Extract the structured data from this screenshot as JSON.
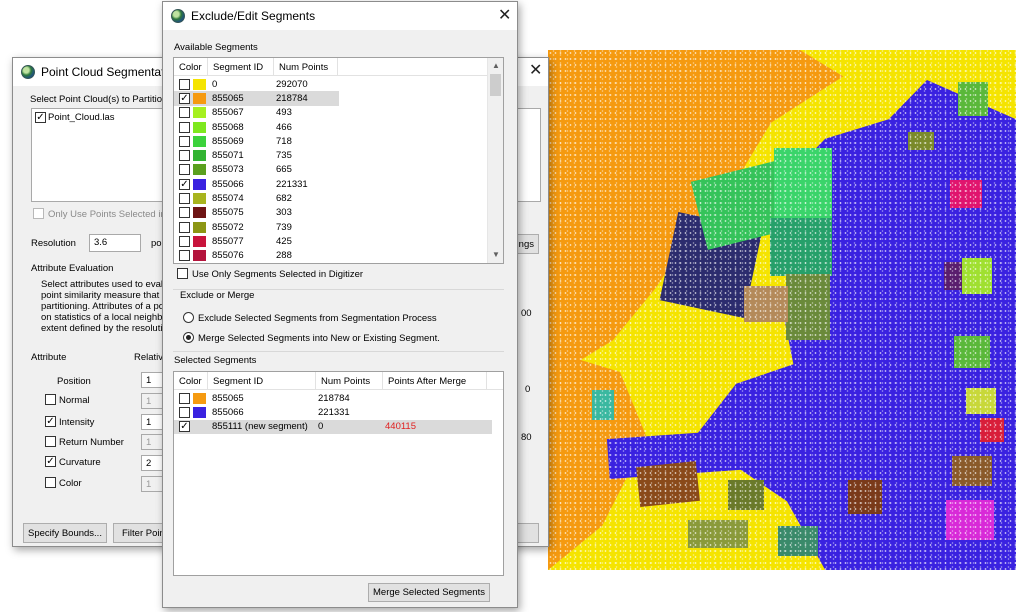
{
  "segmentation_dialog": {
    "title": "Point Cloud Segmentation b",
    "select_label": "Select Point Cloud(s) to Partition",
    "point_cloud_file": "Point_Cloud.las",
    "only_selected_label": "Only Use Points Selected in D",
    "resolution_label": "Resolution",
    "resolution_value": "3.6",
    "resolution_unit": "po",
    "settings_button_fragment": "ngs",
    "attribute_eval_heading": "Attribute Evaluation",
    "attribute_eval_text": [
      "Select attributes used to evalu",
      "point similarity measure that in",
      "partitioning. Attributes of a po",
      "on statistics of a local neighbo",
      "extent defined by the resoluti"
    ],
    "side_value_1": "00",
    "side_value_2": "0",
    "side_value_3": "80",
    "attribute_col": "Attribute",
    "relative_col": "Relativ",
    "attributes": [
      {
        "name": "Position",
        "checkbox": false,
        "checked": false,
        "value": "1",
        "enabled": true
      },
      {
        "name": "Normal",
        "checkbox": true,
        "checked": false,
        "value": "1",
        "enabled": false
      },
      {
        "name": "Intensity",
        "checkbox": true,
        "checked": true,
        "value": "1",
        "enabled": true
      },
      {
        "name": "Return Number",
        "checkbox": true,
        "checked": false,
        "value": "1",
        "enabled": false
      },
      {
        "name": "Curvature",
        "checkbox": true,
        "checked": true,
        "value": "2",
        "enabled": true
      },
      {
        "name": "Color",
        "checkbox": true,
        "checked": false,
        "value": "1",
        "enabled": false
      }
    ],
    "specify_bounds_button": "Specify Bounds...",
    "filter_points_button": "Filter Poin",
    "right_button_fragment": "e"
  },
  "edit_dialog": {
    "title": "Exclude/Edit Segments",
    "available_heading": "Available Segments",
    "columns": [
      "Color",
      "Segment ID",
      "Num Points"
    ],
    "available_segments": [
      {
        "checked": false,
        "color": "#f5e400",
        "id": "0",
        "points": "292070",
        "selected": false
      },
      {
        "checked": true,
        "color": "#f59a10",
        "id": "855065",
        "points": "218784",
        "selected": true
      },
      {
        "checked": false,
        "color": "#a6f020",
        "id": "855067",
        "points": "493",
        "selected": false
      },
      {
        "checked": false,
        "color": "#7ee81e",
        "id": "855068",
        "points": "466",
        "selected": false
      },
      {
        "checked": false,
        "color": "#3cd23c",
        "id": "855069",
        "points": "718",
        "selected": false
      },
      {
        "checked": false,
        "color": "#32b432",
        "id": "855071",
        "points": "735",
        "selected": false
      },
      {
        "checked": false,
        "color": "#5aa01e",
        "id": "855073",
        "points": "665",
        "selected": false
      },
      {
        "checked": true,
        "color": "#3a22e0",
        "id": "855066",
        "points": "221331",
        "selected": false
      },
      {
        "checked": false,
        "color": "#a8b41e",
        "id": "855074",
        "points": "682",
        "selected": false
      },
      {
        "checked": false,
        "color": "#6e1414",
        "id": "855075",
        "points": "303",
        "selected": false
      },
      {
        "checked": false,
        "color": "#8c9614",
        "id": "855072",
        "points": "739",
        "selected": false
      },
      {
        "checked": false,
        "color": "#c8143c",
        "id": "855077",
        "points": "425",
        "selected": false
      },
      {
        "checked": false,
        "color": "#b4143c",
        "id": "855076",
        "points": "288",
        "selected": false
      }
    ],
    "use_only_selected_label": "Use Only Segments Selected in Digitizer",
    "exclude_merge_heading": "Exclude or Merge",
    "exclude_option": "Exclude Selected Segments from Segmentation Process",
    "merge_option": "Merge Selected Segments into New or Existing Segment.",
    "merge_selected": true,
    "selected_heading": "Selected Segments",
    "selected_columns": [
      "Color",
      "Segment ID",
      "Num Points",
      "Points After Merge"
    ],
    "selected_segments": [
      {
        "checked": false,
        "color": "#f59a10",
        "id": "855065",
        "points": "218784",
        "after": "",
        "highlight": false
      },
      {
        "checked": false,
        "color": "#3a22e0",
        "id": "855066",
        "points": "221331",
        "after": "",
        "highlight": false
      },
      {
        "checked": true,
        "color": "",
        "id": "855111 (new segment)",
        "points": "0",
        "after": "440115",
        "highlight": true
      }
    ],
    "merge_after_color": "#e02020",
    "merge_button": "Merge Selected Segments"
  },
  "colors": {
    "ground": "#f5e400",
    "orange_segment": "#f59a10",
    "blue_segment": "#3a22e0"
  }
}
